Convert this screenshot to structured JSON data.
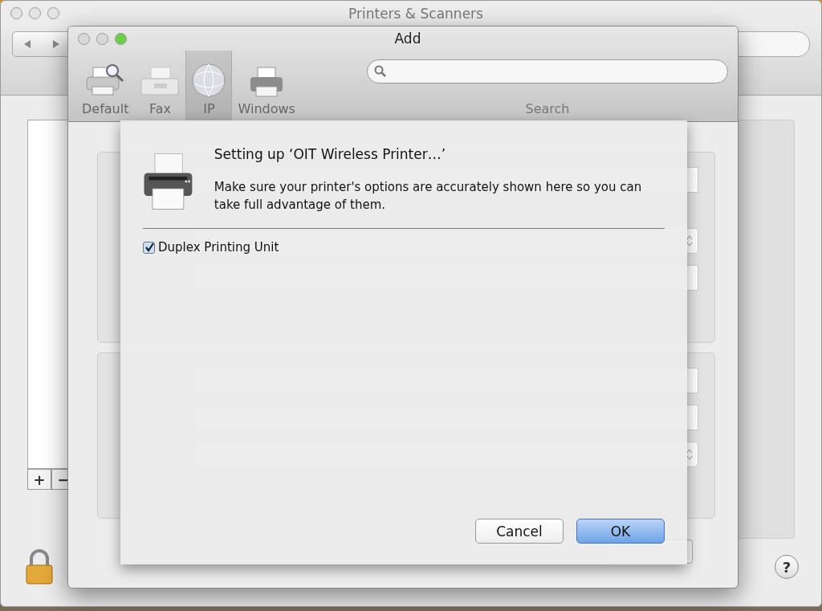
{
  "main_window": {
    "title": "Printers & Scanners",
    "list_buttons": [
      "+",
      "−"
    ],
    "help": "?"
  },
  "add_window": {
    "title": "Add",
    "toolbar": [
      {
        "label": "Default",
        "kind": "default",
        "selected": false
      },
      {
        "label": "Fax",
        "kind": "fax",
        "selected": false
      },
      {
        "label": "IP",
        "kind": "ip",
        "selected": true
      },
      {
        "label": "Windows",
        "kind": "windows",
        "selected": false
      }
    ],
    "search": {
      "label": "Search"
    },
    "groups": [
      [
        {
          "kind": "text"
        },
        {
          "kind": "select"
        },
        {
          "kind": "text"
        }
      ],
      [
        {
          "kind": "text"
        },
        {
          "kind": "text"
        },
        {
          "kind": "select"
        }
      ]
    ]
  },
  "sheet": {
    "title": "Setting up ‘OIT Wireless Printer…’",
    "description": "Make sure your printer's options are accurately shown here so you can take full advantage of them.",
    "options": [
      {
        "label": "Duplex Printing Unit",
        "checked": true
      }
    ],
    "buttons": [
      {
        "label": "Cancel",
        "default": false
      },
      {
        "label": "OK",
        "default": true
      }
    ]
  }
}
